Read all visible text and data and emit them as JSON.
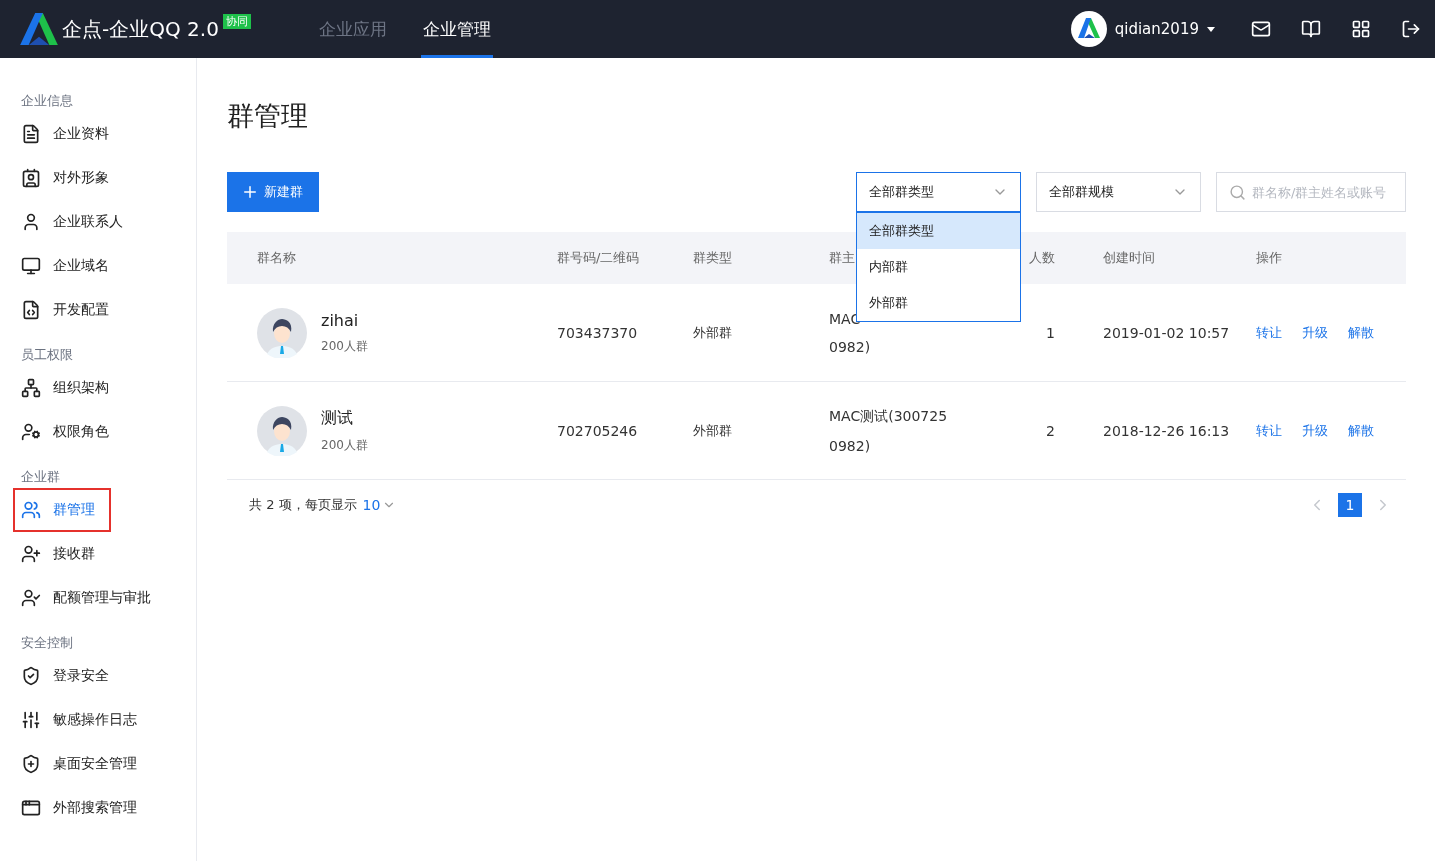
{
  "header": {
    "brand": "企点-企业QQ 2.0",
    "badge": "协同",
    "tabs": [
      {
        "label": "企业应用",
        "selected": false
      },
      {
        "label": "企业管理",
        "selected": true
      }
    ],
    "user": "qidian2019"
  },
  "sidebar": {
    "sections": [
      {
        "title": "企业信息",
        "items": [
          {
            "label": "企业资料",
            "selected": false,
            "highlighted": false
          },
          {
            "label": "对外形象",
            "selected": false,
            "highlighted": false
          },
          {
            "label": "企业联系人",
            "selected": false,
            "highlighted": false
          },
          {
            "label": "企业域名",
            "selected": false,
            "highlighted": false
          },
          {
            "label": "开发配置",
            "selected": false,
            "highlighted": false
          }
        ]
      },
      {
        "title": "员工权限",
        "items": [
          {
            "label": "组织架构",
            "selected": false,
            "highlighted": false
          },
          {
            "label": "权限角色",
            "selected": false,
            "highlighted": false
          }
        ]
      },
      {
        "title": "企业群",
        "items": [
          {
            "label": "群管理",
            "selected": true,
            "highlighted": true
          },
          {
            "label": "接收群",
            "selected": false,
            "highlighted": false
          },
          {
            "label": "配额管理与审批",
            "selected": false,
            "highlighted": false
          }
        ]
      },
      {
        "title": "安全控制",
        "items": [
          {
            "label": "登录安全",
            "selected": false,
            "highlighted": false
          },
          {
            "label": "敏感操作日志",
            "selected": false,
            "highlighted": false
          },
          {
            "label": "桌面安全管理",
            "selected": false,
            "highlighted": false
          },
          {
            "label": "外部搜索管理",
            "selected": false,
            "highlighted": false
          }
        ]
      }
    ]
  },
  "page_title": "群管理",
  "new_button": "新建群",
  "type_select": {
    "value": "全部群类型",
    "expanded": true,
    "options": [
      {
        "label": "全部群类型",
        "selected": true
      },
      {
        "label": "内部群",
        "selected": false
      },
      {
        "label": "外部群",
        "selected": false
      }
    ]
  },
  "size_select": {
    "value": "全部群规模"
  },
  "search": {
    "placeholder": "群名称/群主姓名或账号"
  },
  "table": {
    "columns": [
      "群名称",
      "群号码/二维码",
      "群类型",
      "群主",
      "人数",
      "创建时间",
      "操作"
    ],
    "rows": [
      {
        "name": "zihai",
        "size": "200人群",
        "number": "703437370",
        "type": "外部群",
        "owner_lines": [
          "MAC",
          "0982)"
        ],
        "count": "1",
        "created": "2019-01-02 10:57",
        "actions": [
          "转让",
          "升级",
          "解散"
        ]
      },
      {
        "name": "测试",
        "size": "200人群",
        "number": "702705246",
        "type": "外部群",
        "owner_lines": [
          "MAC测试(300725",
          "0982)"
        ],
        "count": "2",
        "created": "2018-12-26 16:13",
        "actions": [
          "转让",
          "升级",
          "解散"
        ]
      }
    ]
  },
  "pagination": {
    "summary": "共 2 项，每页显示",
    "page_size": "10",
    "pages": [
      {
        "label": "1",
        "selected": true
      }
    ]
  }
}
